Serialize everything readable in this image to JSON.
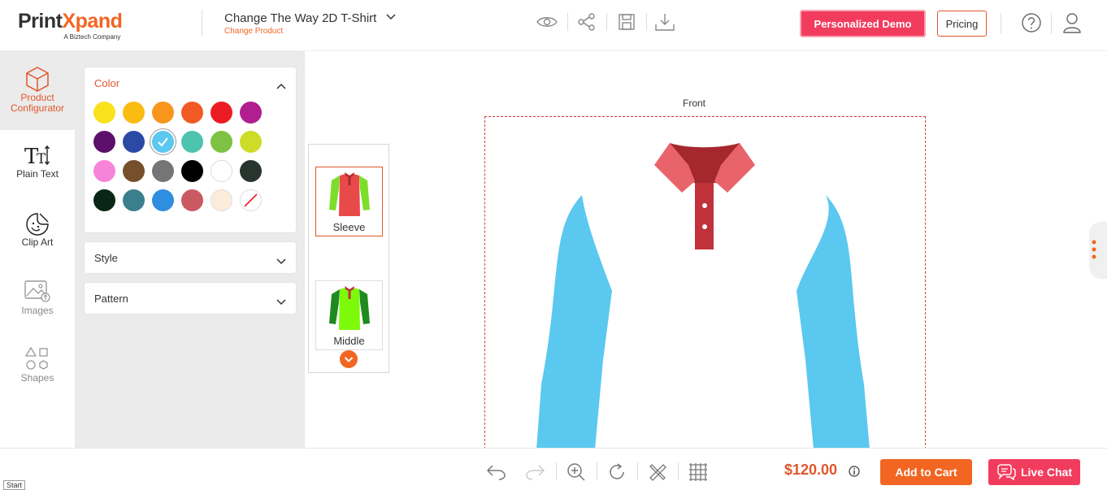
{
  "header": {
    "logo_text_a": "Print",
    "logo_text_b": "X",
    "logo_text_c": "pand",
    "logo_tagline": "A Biztech Company",
    "product_title": "Change The Way 2D T-Shirt",
    "change_product": "Change Product",
    "demo_button": "Personalized Demo",
    "pricing_button": "Pricing"
  },
  "sidebar": {
    "items": [
      {
        "label_1": "Product",
        "label_2": "Configurator",
        "icon": "cube-icon"
      },
      {
        "label_1": "Plain Text",
        "icon": "text-icon"
      },
      {
        "label_1": "Clip Art",
        "icon": "clipart-icon"
      },
      {
        "label_1": "Images",
        "icon": "image-icon"
      },
      {
        "label_1": "Shapes",
        "icon": "shapes-icon"
      }
    ]
  },
  "panel": {
    "color_title": "Color",
    "style_title": "Style",
    "pattern_title": "Pattern",
    "colors": [
      "#f9e11b",
      "#fbbc12",
      "#f8951d",
      "#f15a24",
      "#ec1c24",
      "#b01e8f",
      "#5c0f6b",
      "#2a4aa5",
      "#5bc8f0",
      "#4dc3b0",
      "#7dc242",
      "#cddc29",
      "#f784d8",
      "#75502a",
      "#757575",
      "#000000",
      "#ffffff",
      "#27352e",
      "#0a2615",
      "#3b7f8c",
      "#2e8ee0",
      "#c95a62",
      "#fdebdb",
      "none"
    ],
    "selected_color_index": 8
  },
  "parts": {
    "items": [
      {
        "label": "Sleeve",
        "active": true
      },
      {
        "label": "Middle",
        "active": false
      }
    ]
  },
  "canvas": {
    "view_label": "Front",
    "shirt_colors": {
      "sleeve": "#5bc8f0",
      "collar_outer": "#e8646a",
      "collar_inner": "#a4282c",
      "placket": "#c0313a"
    }
  },
  "footer": {
    "price": "$120.00",
    "add_to_cart": "Add to Cart",
    "live_chat": "Live Chat",
    "start_label": "Start"
  }
}
